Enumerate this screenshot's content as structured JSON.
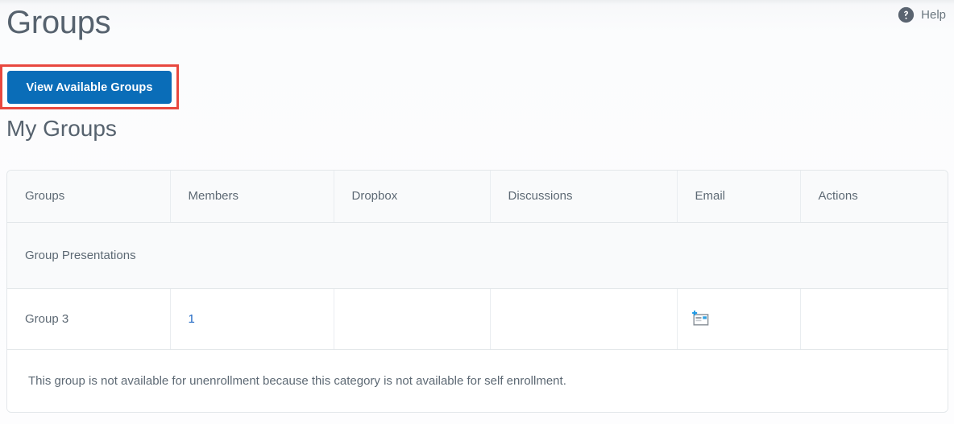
{
  "header": {
    "title": "Groups",
    "help_label": "Help",
    "help_icon": "question-circle-icon"
  },
  "toolbar": {
    "view_available_groups_label": "View Available Groups",
    "highlight_color": "#e8483f",
    "button_color": "#0a6db8"
  },
  "section": {
    "title": "My Groups"
  },
  "table": {
    "columns": [
      "Groups",
      "Members",
      "Dropbox",
      "Discussions",
      "Email",
      "Actions"
    ],
    "category_row": {
      "name": "Group Presentations"
    },
    "rows": [
      {
        "group": "Group 3",
        "members": "1",
        "dropbox": "",
        "discussions": "",
        "email_icon": "email-compose-icon",
        "actions": ""
      }
    ],
    "notice": "This group is not available for unenrollment because this category is not available for self enrollment."
  },
  "colors": {
    "link": "#2068c4",
    "text": "#5d6974",
    "border": "#e3e7ea"
  }
}
